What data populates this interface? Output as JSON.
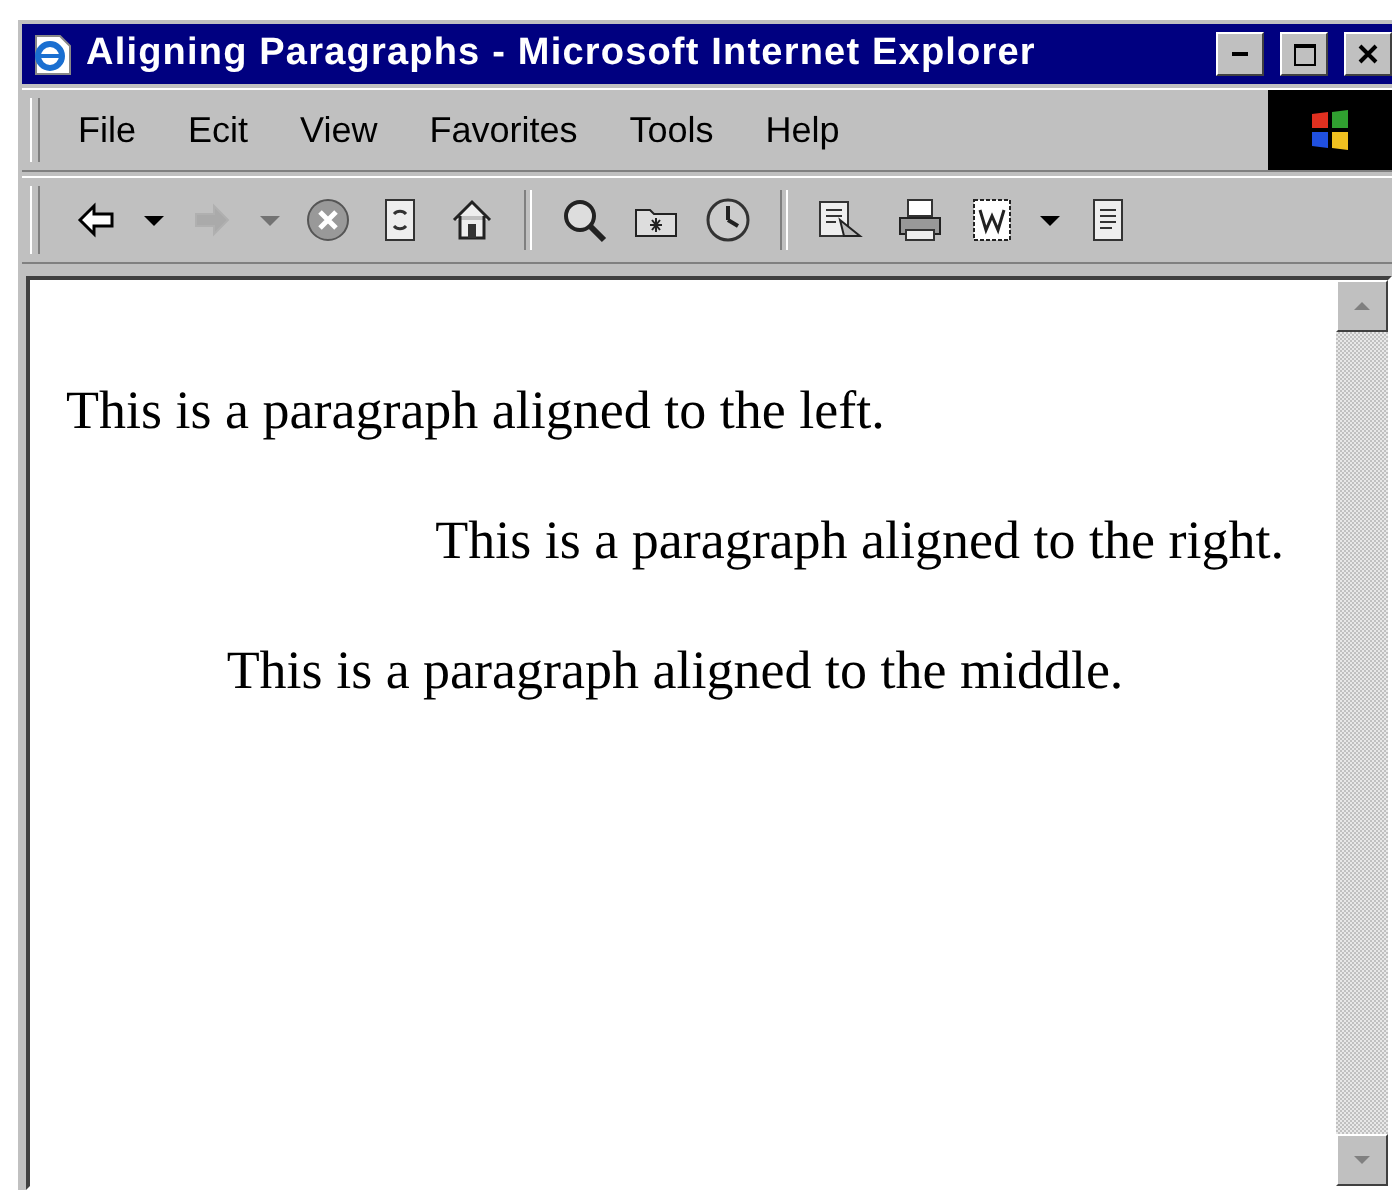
{
  "window": {
    "title": "Aligning Paragraphs - Microsoft Internet Explorer"
  },
  "menu": [
    "File",
    "Ecit",
    "View",
    "Favorites",
    "Tools",
    "Help"
  ],
  "toolbar": [
    [
      {
        "kind": "back",
        "disabled": false
      },
      {
        "kind": "dropdown",
        "disabled": false
      },
      {
        "kind": "forward",
        "disabled": true
      },
      {
        "kind": "dropdown",
        "disabled": true
      },
      {
        "kind": "stop",
        "disabled": false
      },
      {
        "kind": "refresh",
        "disabled": false
      },
      {
        "kind": "home",
        "disabled": false
      }
    ],
    [
      {
        "kind": "search",
        "disabled": false
      },
      {
        "kind": "favorites",
        "disabled": false
      },
      {
        "kind": "history",
        "disabled": false
      }
    ],
    [
      {
        "kind": "mail",
        "disabled": false
      },
      {
        "kind": "print",
        "disabled": false
      },
      {
        "kind": "edit",
        "disabled": false
      },
      {
        "kind": "dropdown",
        "disabled": false
      },
      {
        "kind": "discuss",
        "disabled": false
      }
    ]
  ],
  "paragraphs": [
    {
      "text": "This is a paragraph aligned to the left.",
      "kind": "left"
    },
    {
      "text": "This is a paragraph aligned to the right.",
      "kind": "right"
    },
    {
      "text": "This is a paragraph aligned to the middle.",
      "kind": "center"
    }
  ]
}
